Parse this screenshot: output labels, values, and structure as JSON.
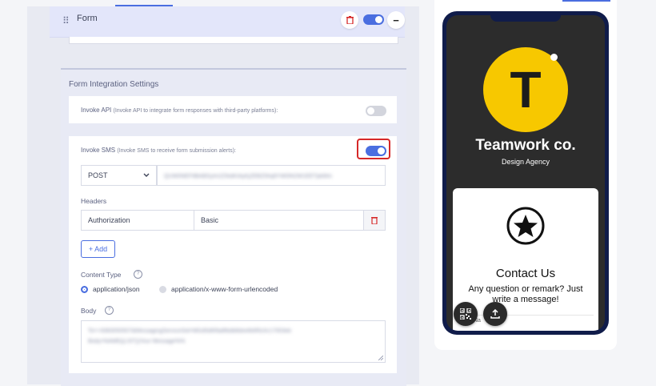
{
  "form_block": {
    "title": "Form"
  },
  "settings": {
    "title": "Form Integration Settings",
    "invoke_api": {
      "label": "Invoke API",
      "hint": "(Invoke API to integrate form responses with third-party platforms):",
      "enabled": false
    },
    "invoke_sms": {
      "label": "Invoke SMS",
      "hint": "(Invoke SMS to receive form submission alerts):",
      "enabled": true,
      "method": "POST",
      "url_value": "QUW0NEF9BABSyIm2ZIkdKIAyKjZEBZ0hq9YW0IN2W1EETpkMm",
      "headers_label": "Headers",
      "header_key": "Authorization",
      "header_value": "Basic",
      "add_label": "+ Add",
      "content_type_label": "Content Type",
      "content_type_options": [
        {
          "label": "application/json",
          "selected": true
        },
        {
          "label": "application/x-www-form-urlencoded",
          "selected": false
        }
      ],
      "body_label": "Body",
      "body_value": "To=+9383050507&MessagingServiceSid=MGd5d6f9a8fbdb8deefb6f5c0c17003eb",
      "body_value_line2": "Body=NAME{{LIST}}Your Message%%"
    }
  },
  "preview": {
    "logo_letter": "T",
    "company_name": "Teamwork co.",
    "company_subtitle": "Design Agency",
    "contact_title": "Contact Us",
    "contact_text": "Any question or remark? Just write a message!",
    "name_field_hint": "Na"
  },
  "colors": {
    "accent": "#4a6ee0",
    "highlight": "#d62828",
    "logo_yellow": "#f7c800"
  }
}
